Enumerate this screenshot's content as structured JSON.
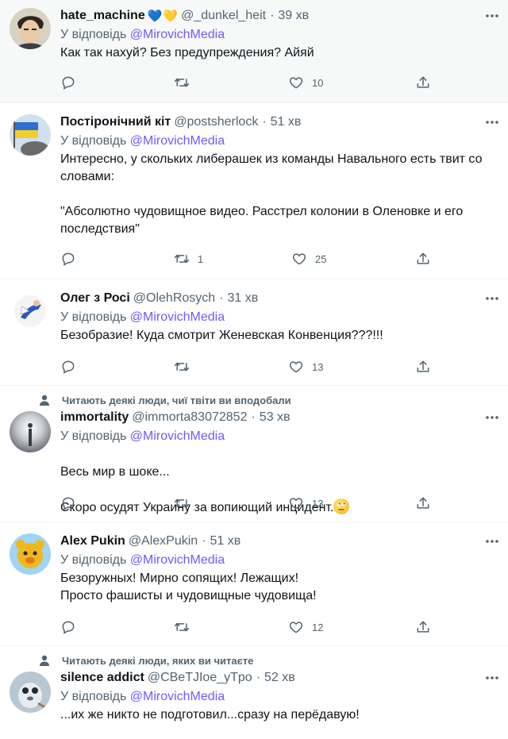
{
  "reply_prefix": "У відповідь",
  "tweets": [
    {
      "name": "hate_machine",
      "badges": [
        "💙",
        "💛"
      ],
      "handle": "@_dunkel_heit",
      "time": "39 хв",
      "reply_to": "@MirovichMedia",
      "text": "Как так нахуй? Без предупреждения? Айяй",
      "retweets": "",
      "likes": "10",
      "social_context": ""
    },
    {
      "name": "Постіронічний кіт",
      "handle": "@postsherlock",
      "time": "51 хв",
      "reply_to": "@MirovichMedia",
      "text": "Интересно, у скольких либерашек из команды Навального есть твит со словами:\n\n\"Абсолютно чудовищное видео. Расстрел колонии в Оленовке и его последствия\"",
      "retweets": "1",
      "likes": "25",
      "social_context": ""
    },
    {
      "name": "Олег з Росі",
      "handle": "@OlehRosych",
      "time": "31 хв",
      "reply_to": "@MirovichMedia",
      "text": "Безобразие! Куда смотрит Женевская Конвенция???!!!",
      "retweets": "",
      "likes": "13",
      "social_context": ""
    },
    {
      "name": "immortality",
      "handle": "@immorta83072852",
      "time": "53 хв",
      "reply_to": "@MirovichMedia",
      "text_line1": "Весь мир в шоке...",
      "text_line2": "Скоро осудят Украину за вопиющий инцидент.",
      "emoji": "face-with-rolling-eyes",
      "retweets": "",
      "likes": "13",
      "social_context": "Читають деякі люди, чиї твіти ви вподобали"
    },
    {
      "name": "Alex Pukin",
      "handle": "@AlexPukin",
      "time": "51 хв",
      "reply_to": "@MirovichMedia",
      "text": "Безоружных! Мирно сопящих! Лежащих!\nПросто фашисты и чудовищные чудовища!",
      "retweets": "",
      "likes": "12",
      "social_context": ""
    },
    {
      "name": "silence addict",
      "handle": "@CBeTJIoe_yTpo",
      "time": "52 хв",
      "reply_to": "@MirovichMedia",
      "text": "...их же никто не подготовил...сразу на перёдавую!",
      "social_context": "Читають деякі люди, яких ви читаєте"
    }
  ],
  "colors": {
    "accent": "#7856ff",
    "secondary": "#536471",
    "highlight_bg": "#f7f9f9"
  },
  "icons": [
    "reply-icon",
    "retweet-icon",
    "like-icon",
    "share-icon",
    "more-icon",
    "person-icon"
  ]
}
